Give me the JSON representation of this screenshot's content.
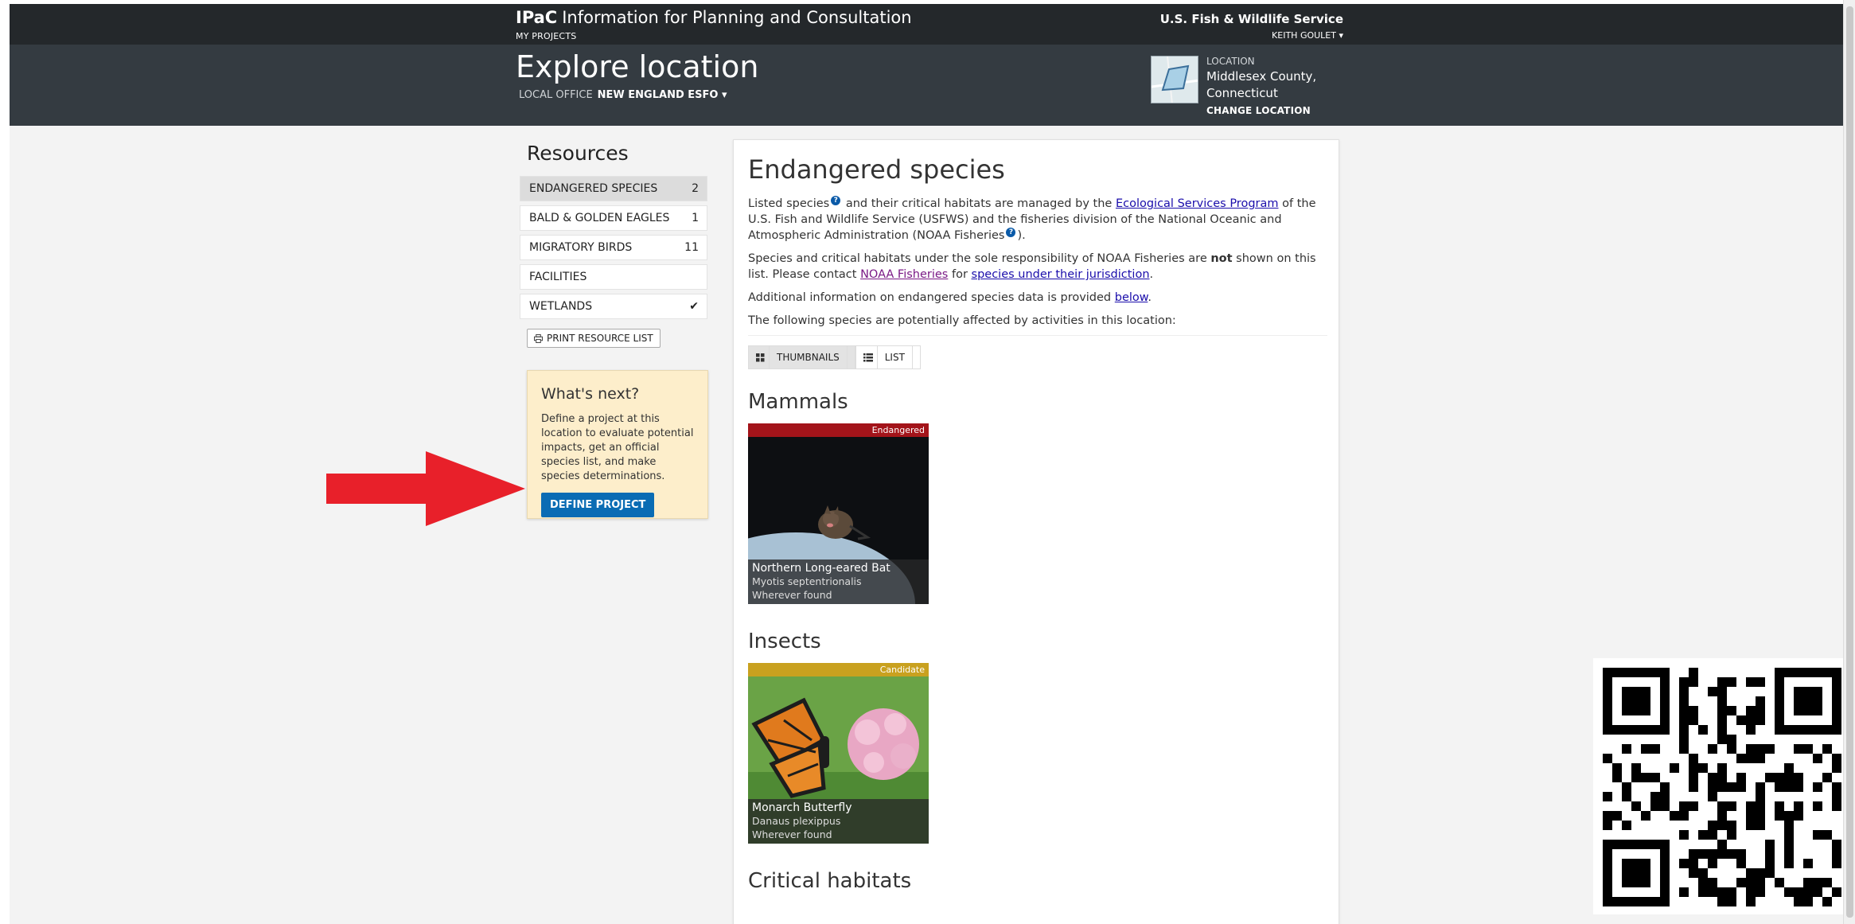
{
  "header": {
    "brand_bold": "IPaC",
    "brand_title": "Information for Planning and Consultation",
    "my_projects": "MY PROJECTS",
    "agency": "U.S. Fish & Wildlife Service",
    "user": "KEITH GOULET ▾"
  },
  "subheader": {
    "title": "Explore location",
    "local_office_label": "LOCAL OFFICE",
    "local_office": "NEW ENGLAND ESFO ▾",
    "location_label": "LOCATION",
    "location_line1": "Middlesex County,",
    "location_line2": "Connecticut",
    "change_location": "CHANGE LOCATION"
  },
  "sidebar": {
    "title": "Resources",
    "items": [
      {
        "label": "ENDANGERED SPECIES",
        "count": "2"
      },
      {
        "label": "BALD & GOLDEN EAGLES",
        "count": "1"
      },
      {
        "label": "MIGRATORY BIRDS",
        "count": "11"
      },
      {
        "label": "FACILITIES",
        "count": ""
      },
      {
        "label": "WETLANDS",
        "count": "✔"
      }
    ],
    "print_label": "PRINT RESOURCE LIST",
    "next_title": "What's next?",
    "next_text": "Define a project at this location to evaluate potential impacts, get an official species list, and make species determinations.",
    "define_label": "DEFINE PROJECT"
  },
  "main": {
    "title": "Endangered species",
    "p1_a": "Listed species",
    "p1_b": " and their critical habitats are managed by the ",
    "p1_link": "Ecological Services Program",
    "p1_c": " of the U.S. Fish and Wildlife Service (USFWS) and the fisheries division of the National Oceanic and Atmospheric Administration (NOAA Fisheries",
    "p1_d": ").",
    "p2_a": "Species and critical habitats under the sole responsibility of NOAA Fisheries are ",
    "p2_not": "not",
    "p2_b": " shown on this list. Please contact ",
    "p2_link1": "NOAA Fisheries",
    "p2_c": " for ",
    "p2_link2": "species under their jurisdiction",
    "p2_d": ".",
    "p3_a": "Additional information on endangered species data is provided ",
    "p3_link": "below",
    "p3_b": ".",
    "p4": "The following species are potentially affected by activities in this location:",
    "view_thumbnails": "THUMBNAILS",
    "view_list": "LIST",
    "groups": [
      {
        "title": "Mammals",
        "species": {
          "status": "Endangered",
          "status_color": "#a3141a",
          "name": "Northern Long-eared Bat",
          "sci": "Myotis septentrionalis",
          "where": "Wherever found"
        }
      },
      {
        "title": "Insects",
        "species": {
          "status": "Candidate",
          "status_color": "#c9a11f",
          "name": "Monarch Butterfly",
          "sci": "Danaus plexippus",
          "where": "Wherever found"
        }
      }
    ],
    "critical_habitats": "Critical habitats"
  },
  "help_glyph": "?",
  "colors": {
    "topbar": "#24282b",
    "subbar": "#343b41",
    "define_button": "#0a6cb4",
    "arrow": "#e8202a",
    "note_bg": "#fdeecb"
  }
}
